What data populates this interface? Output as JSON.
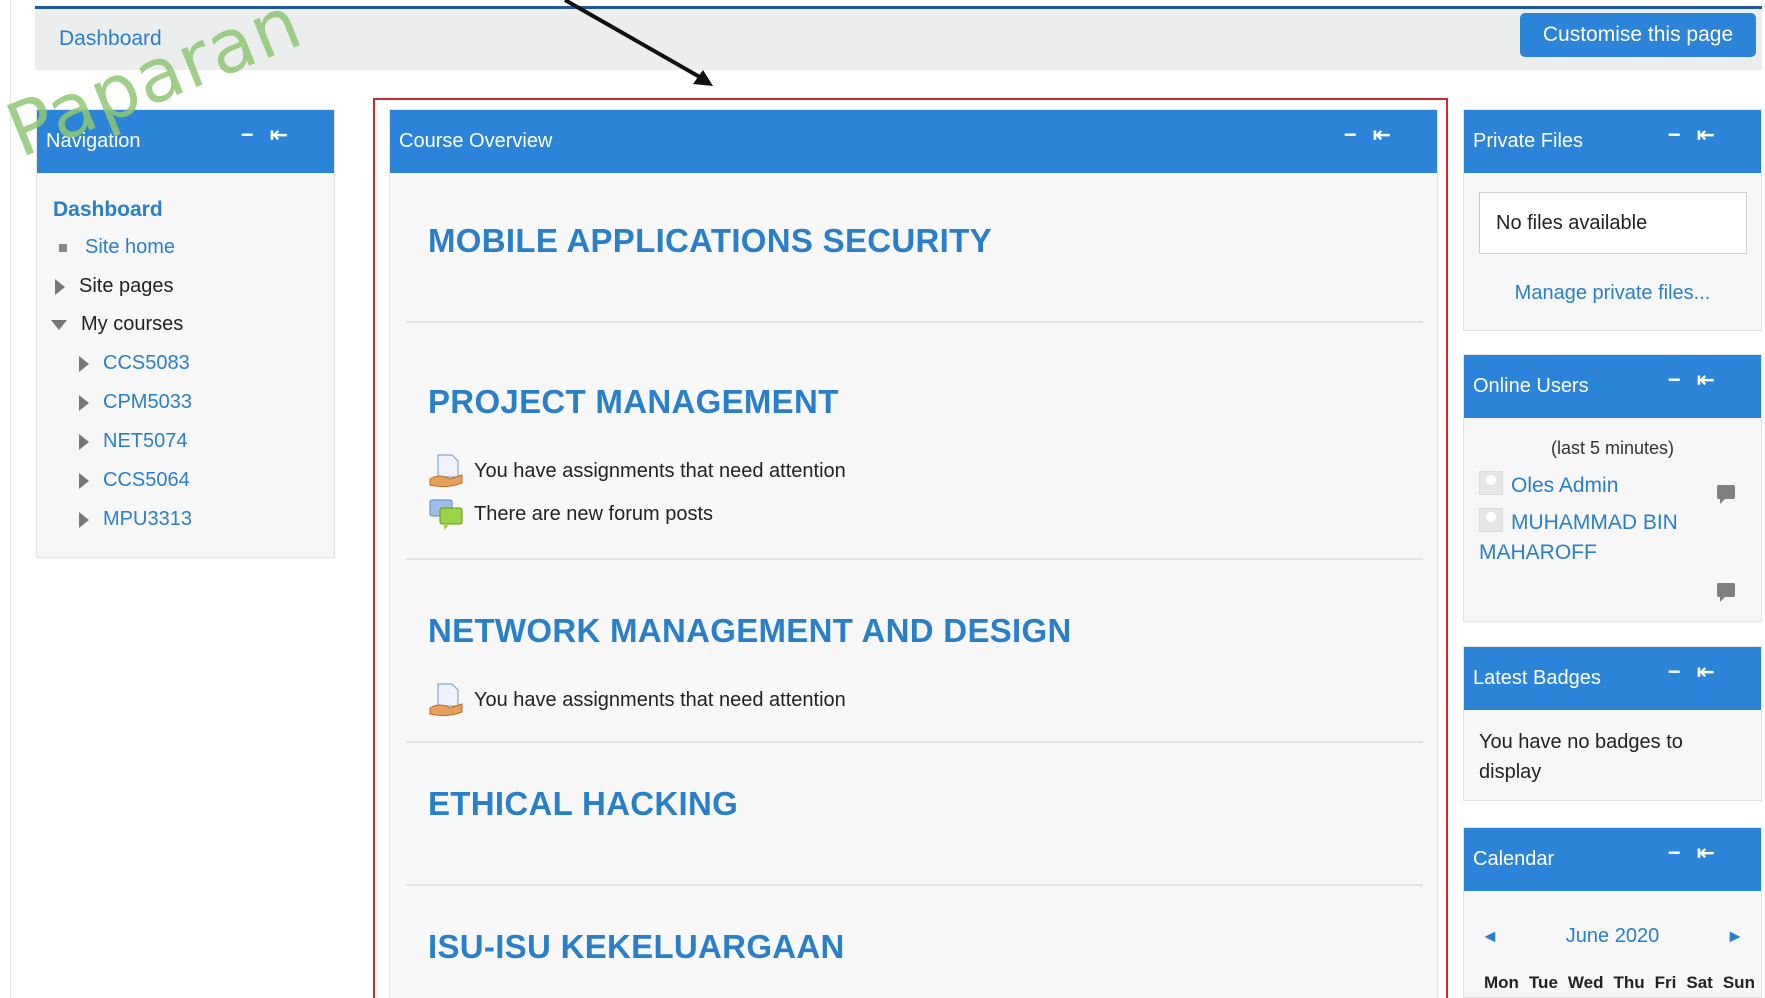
{
  "header": {
    "breadcrumb": "Dashboard",
    "customise_button": "Customise this page"
  },
  "navigation": {
    "title": "Navigation",
    "watermark": "Paparan",
    "dashboard": "Dashboard",
    "site_home": "Site home",
    "site_pages": "Site pages",
    "my_courses": "My courses",
    "courses": [
      "CCS5083",
      "CPM5033",
      "NET5074",
      "CCS5064",
      "MPU3313"
    ]
  },
  "course_overview": {
    "title": "Course Overview",
    "courses": [
      {
        "name": "MOBILE APPLICATIONS SECURITY",
        "notices": []
      },
      {
        "name": "PROJECT MANAGEMENT",
        "notices": [
          "You have assignments that need attention",
          "There are new forum posts"
        ]
      },
      {
        "name": "NETWORK MANAGEMENT AND DESIGN",
        "notices": [
          "You have assignments that need attention"
        ]
      },
      {
        "name": "ETHICAL HACKING",
        "notices": []
      },
      {
        "name": "ISU-ISU KEKELUARGAAN",
        "notices": []
      }
    ]
  },
  "private_files": {
    "title": "Private Files",
    "empty": "No files available",
    "manage_link": "Manage private files..."
  },
  "online_users": {
    "title": "Online Users",
    "period": "(last 5 minutes)",
    "users": [
      "Oles Admin",
      "MUHAMMAD BIN MAHAROFF"
    ]
  },
  "latest_badges": {
    "title": "Latest Badges",
    "empty": "You have no badges to display"
  },
  "calendar": {
    "title": "Calendar",
    "month": "June 2020",
    "prev": "◄",
    "next": "►",
    "weekdays": [
      "Mon",
      "Tue",
      "Wed",
      "Thu",
      "Fri",
      "Sat",
      "Sun"
    ]
  },
  "block_controls": "− ⇤",
  "colors": {
    "accent": "#2b84d8",
    "link": "#2a7fc9",
    "frame": "#d9262c"
  }
}
